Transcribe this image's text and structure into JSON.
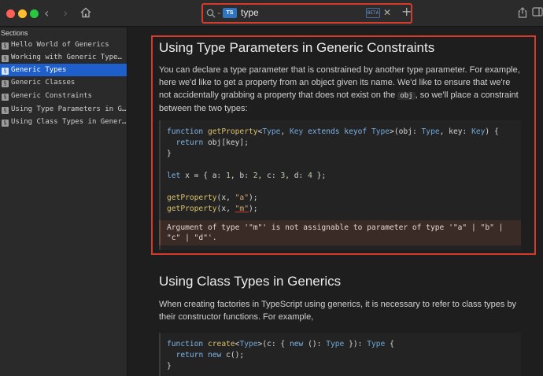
{
  "search": {
    "badge": "TS",
    "query": "type",
    "kbd": "BETA",
    "clear": "✕",
    "add": "+"
  },
  "nav": {
    "back": "‹",
    "forward": "›"
  },
  "sidebar": {
    "title": "Sections",
    "items": [
      {
        "label": "Hello World of Generics"
      },
      {
        "label": "Working with Generic Type…"
      },
      {
        "label": "Generic Types"
      },
      {
        "label": "Generic Classes"
      },
      {
        "label": "Generic Constraints"
      },
      {
        "label": "Using Type Parameters in G…"
      },
      {
        "label": "Using Class Types in Gener…"
      }
    ]
  },
  "section1": {
    "title": "Using Type Parameters in Generic Constraints",
    "para_a": "You can declare a type parameter that is constrained by another type parameter. For example, here we'd like to get a property from an object given its name. We'd like to ensure that we're not accidentally grabbing a property that does not exist on the ",
    "para_code": "obj",
    "para_b": ", so we'll place a constraint between the two types:",
    "code": {
      "l1_kw": "function",
      "l1_fn": "getProperty",
      "l1_a": "<",
      "l1_t1": "Type",
      "l1_b": ", ",
      "l1_t2": "Key",
      "l1_kw2": " extends keyof ",
      "l1_t3": "Type",
      "l1_c": ">(obj: ",
      "l1_t4": "Type",
      "l1_d": ", key: ",
      "l1_t5": "Key",
      "l1_e": ") {",
      "l2_kw": "return",
      "l2_rest": " obj[key];",
      "l3": "}",
      "l5_kw": "let",
      "l5_a": " x = { a: ",
      "l5_n1": "1",
      "l5_b": ", b: ",
      "l5_n2": "2",
      "l5_c": ", c: ",
      "l5_n3": "3",
      "l5_d": ", d: ",
      "l5_n4": "4",
      "l5_e": " };",
      "l7_fn": "getProperty",
      "l7_a": "(x, ",
      "l7_s": "\"a\"",
      "l7_b": ");",
      "l8_fn": "getProperty",
      "l8_a": "(x, ",
      "l8_s": "\"m\"",
      "l8_b": ");"
    },
    "error": "Argument of type '\"m\"' is not assignable to parameter of type '\"a\" | \"b\" | \"c\" | \"d\"'."
  },
  "section2": {
    "title": "Using Class Types in Generics",
    "para": "When creating factories in TypeScript using generics, it is necessary to refer to class types by their constructor functions. For example,",
    "code": {
      "l1_kw": "function",
      "l1_fn": "create",
      "l1_a": "<",
      "l1_t1": "Type",
      "l1_b": ">(c: { ",
      "l1_kw2": "new",
      "l1_c": " (): ",
      "l1_t2": "Type",
      "l1_d": " }): ",
      "l1_t3": "Type",
      "l1_e": " {",
      "l2_kw": "return",
      "l2_kw2": " new",
      "l2_rest": " c();",
      "l3": "}"
    }
  }
}
